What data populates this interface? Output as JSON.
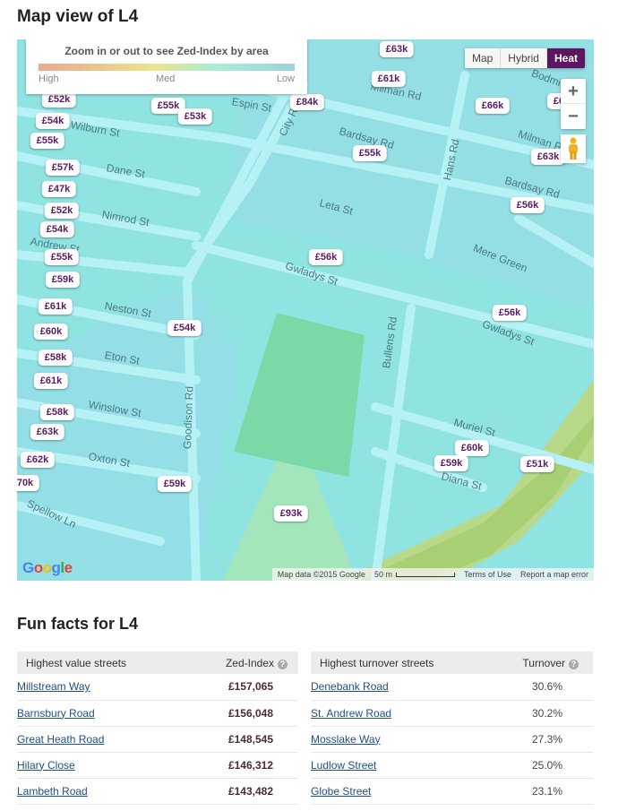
{
  "map_section": {
    "title": "Map view of L4",
    "legend": {
      "title": "Zoom in or out to see Zed-Index by area",
      "high": "High",
      "med": "Med",
      "low": "Low"
    },
    "map_types": [
      "Map",
      "Hybrid",
      "Heat"
    ],
    "active_map_type": "Heat",
    "zoom_in": "+",
    "zoom_out": "−",
    "markers": [
      "£63k",
      "£61k",
      "£66k",
      "£6",
      "£63k",
      "£84k",
      "£52k",
      "£55k",
      "£53k",
      "£54k",
      "£55k",
      "£57k",
      "£47k",
      "£52k",
      "£54k",
      "£55k",
      "£59k",
      "£61k",
      "£60k",
      "£58k",
      "£61k",
      "£58k",
      "£63k",
      "£62k",
      "70k",
      "£55k",
      "£56k",
      "£56k",
      "£54k",
      "£56k",
      "£60k",
      "£59k",
      "£51k",
      "£59k",
      "£93k"
    ],
    "streets": [
      "Wilburn St",
      "Dane St",
      "Nimrod St",
      "Andrew St",
      "Neston St",
      "Eton St",
      "Winslow St",
      "Oxton St",
      "Spellow Ln",
      "Goodison Rd",
      "City Rd",
      "Espin St",
      "Milman Rd",
      "Bardsay Rd",
      "Leta St",
      "Gwladys St",
      "Bullens Rd",
      "Hans Rd",
      "Mere Green",
      "Muriel St",
      "Diana St",
      "Bardsay Rd",
      "Gwladys St",
      "Milman Rd",
      "Bodmin Rd"
    ],
    "attribution": {
      "map_data": "Map data ©2015 Google",
      "scale": "50 m",
      "terms": "Terms of Use",
      "report": "Report a map error",
      "logo": "Google"
    },
    "colors": {
      "accent": "#5b1561",
      "heat_low": "#8fe3e0",
      "heat_high": "#eaa890"
    }
  },
  "facts": {
    "title": "Fun facts for L4",
    "value_table": {
      "headers": [
        "Highest value streets",
        "Zed-Index"
      ],
      "rows": [
        [
          "Millstream Way",
          "£157,065"
        ],
        [
          "Barnsbury Road",
          "£156,048"
        ],
        [
          "Great Heath Road",
          "£148,545"
        ],
        [
          "Hilary Close",
          "£146,312"
        ],
        [
          "Lambeth Road",
          "£143,482"
        ]
      ]
    },
    "turnover_table": {
      "headers": [
        "Highest turnover streets",
        "Turnover"
      ],
      "rows": [
        [
          "Denebank Road",
          "30.6%"
        ],
        [
          "St. Andrew Road",
          "30.2%"
        ],
        [
          "Mosslake Way",
          "27.3%"
        ],
        [
          "Ludlow Street",
          "25.0%"
        ],
        [
          "Globe Street",
          "23.1%"
        ]
      ]
    },
    "help_icon": "?"
  }
}
